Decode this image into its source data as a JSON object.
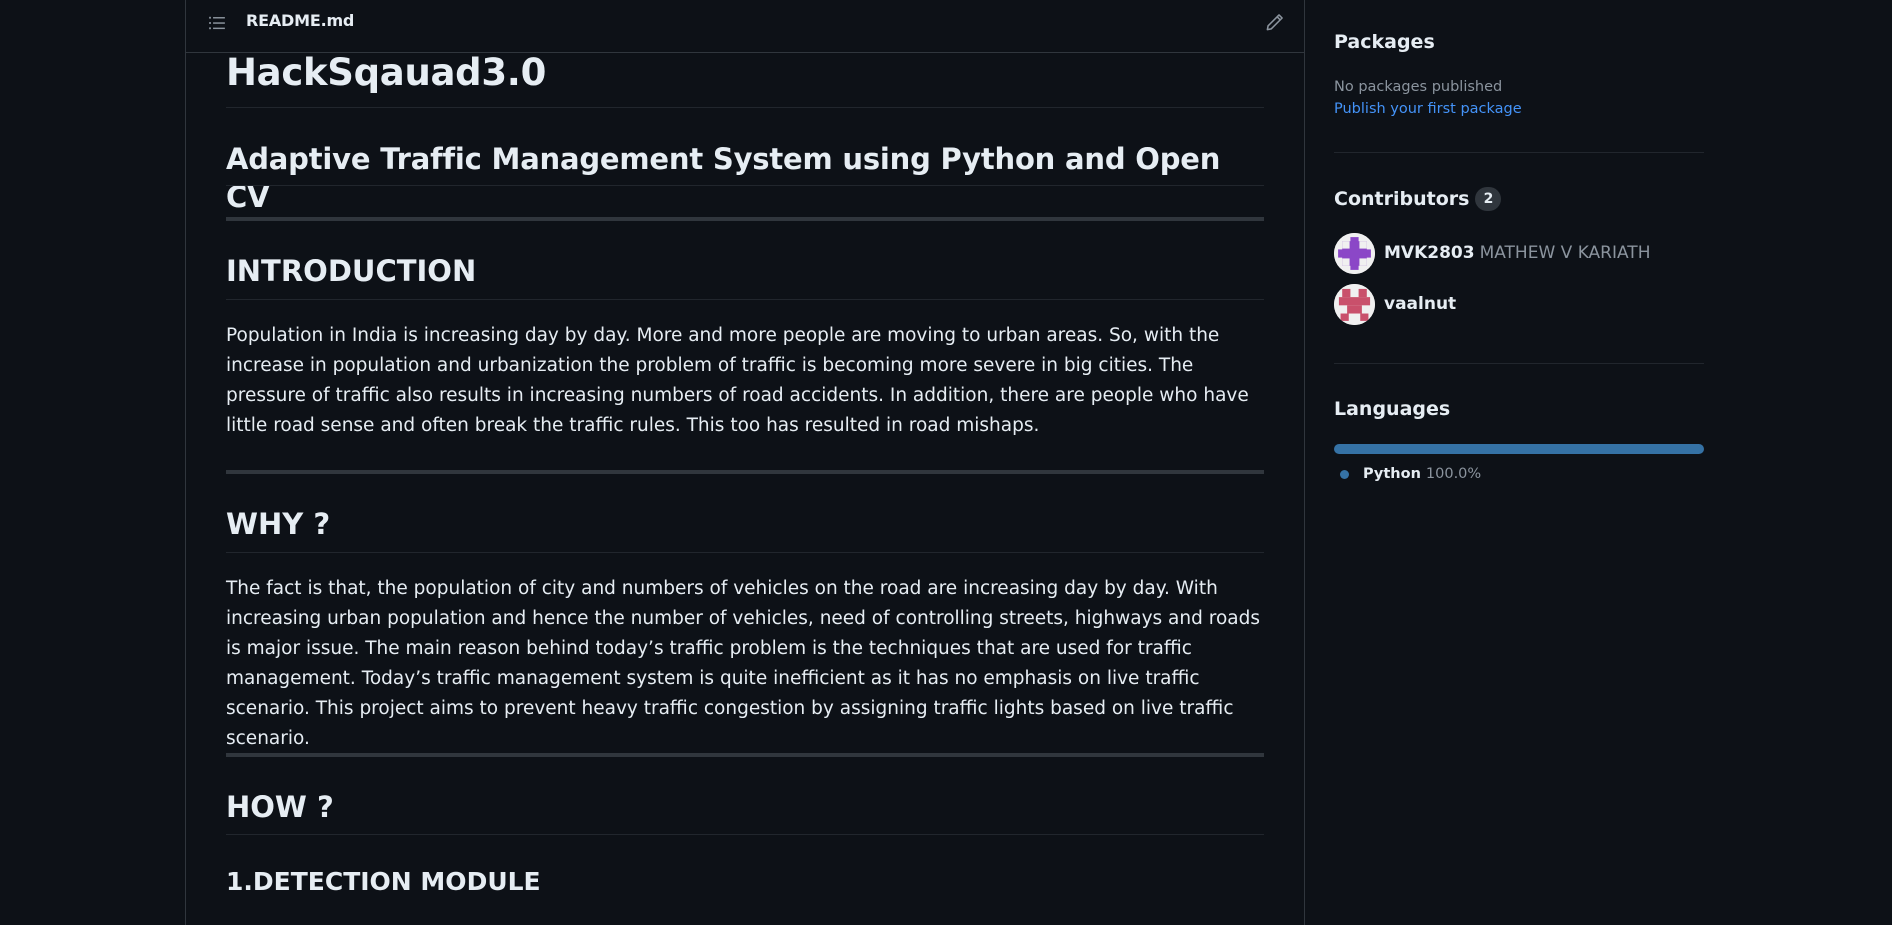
{
  "readme": {
    "filename": "README.md",
    "title": "HackSqauad3.0",
    "subtitle": "Adaptive Traffic Management System using Python and Open CV",
    "sections": {
      "intro_heading": "INTRODUCTION",
      "intro_text": "Population in India is increasing day by day. More and more people are moving to urban areas. So, with the increase in population and urbanization the problem of traffic is becoming more severe in big cities. The pressure of traffic also results in increasing numbers of road accidents. In addition, there are people who have little road sense and often break the traffic rules. This too has resulted in road mishaps.",
      "why_heading": "WHY ?",
      "why_text": "The fact is that, the population of city and numbers of vehicles on the road are increasing day by day. With increasing urban population and hence the number of vehicles, need of controlling streets, highways and roads is major issue. The main reason behind today’s traffic problem is the techniques that are used for traffic management. Today’s traffic management system is quite inefficient as it has no emphasis on live traffic scenario. This project aims to prevent heavy traffic congestion by assigning traffic lights based on live traffic scenario.",
      "how_heading": "HOW ?",
      "detection_heading": "1.DETECTION MODULE"
    }
  },
  "sidebar": {
    "packages": {
      "heading": "Packages",
      "empty_text": "No packages published",
      "publish_link": "Publish your first package"
    },
    "contributors": {
      "heading": "Contributors",
      "count": "2",
      "items": [
        {
          "login": "MVK2803",
          "name": "MATHEW V KARIATH",
          "avatar_color": "#8b47c7"
        },
        {
          "login": "vaalnut",
          "name": "",
          "avatar_color": "#c9506b"
        }
      ]
    },
    "languages": {
      "heading": "Languages",
      "items": [
        {
          "name": "Python",
          "percent": "100.0%",
          "color": "#3572a5",
          "share": 1.0
        }
      ]
    }
  },
  "icons": {
    "toc": "list-icon",
    "edit": "pencil-icon"
  }
}
